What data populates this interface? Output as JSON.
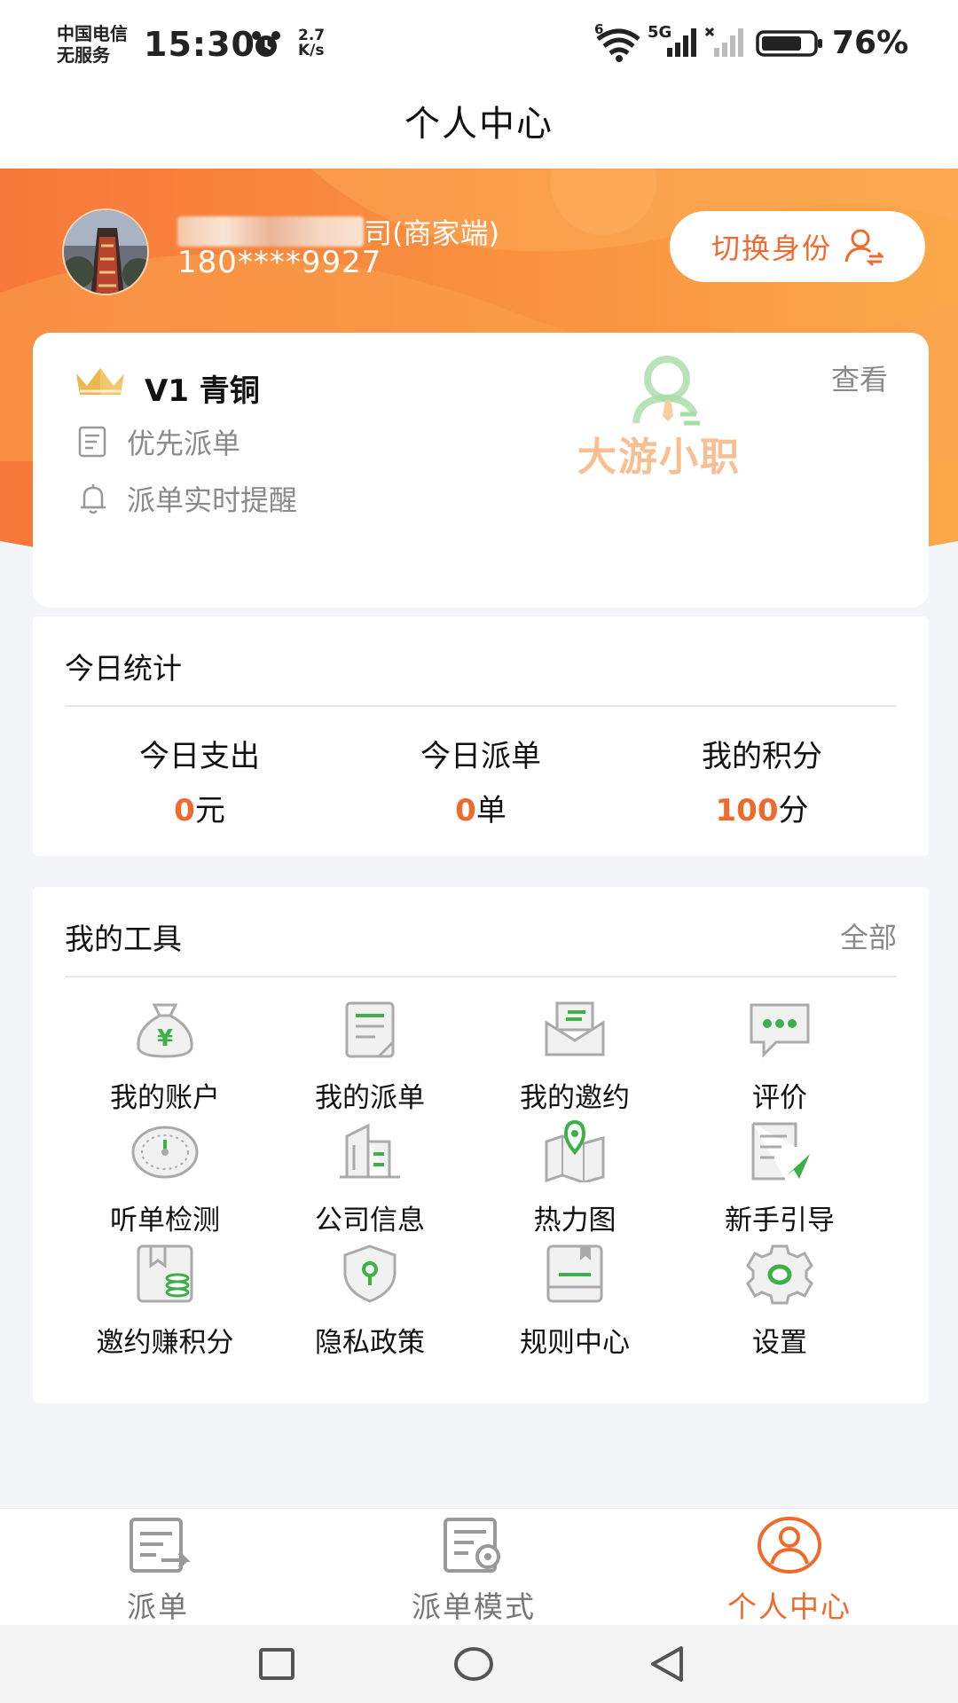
{
  "status_bar": {
    "carrier_line1": "中国电信",
    "carrier_line2": "无服务",
    "time": "15:30",
    "net_speed_value": "2.7",
    "net_speed_unit": "K/s",
    "wifi_badge": "6",
    "network_type": "5G",
    "battery_percent": "76%"
  },
  "page": {
    "title": "个人中心"
  },
  "profile": {
    "company_suffix": "司(商家端)",
    "phone": "180****9927",
    "switch_identity_label": "切换身份"
  },
  "level_card": {
    "level": "V1 青铜",
    "view_label": "查看",
    "perks": [
      "优先派单",
      "派单实时提醒"
    ],
    "watermark": "大游小职"
  },
  "stats": {
    "title": "今日统计",
    "items": [
      {
        "label": "今日支出",
        "value": "0",
        "unit": "元"
      },
      {
        "label": "今日派单",
        "value": "0",
        "unit": "单"
      },
      {
        "label": "我的积分",
        "value": "100",
        "unit": "分"
      }
    ]
  },
  "tools": {
    "title": "我的工具",
    "all_label": "全部",
    "items": [
      {
        "label": "我的账户",
        "icon": "money-bag-icon"
      },
      {
        "label": "我的派单",
        "icon": "clipboard-icon"
      },
      {
        "label": "我的邀约",
        "icon": "envelope-icon"
      },
      {
        "label": "评价",
        "icon": "chat-bubble-icon"
      },
      {
        "label": "听单检测",
        "icon": "gauge-icon"
      },
      {
        "label": "公司信息",
        "icon": "building-icon"
      },
      {
        "label": "热力图",
        "icon": "map-pin-icon"
      },
      {
        "label": "新手引导",
        "icon": "guide-icon"
      },
      {
        "label": "邀约赚积分",
        "icon": "coins-icon"
      },
      {
        "label": "隐私政策",
        "icon": "shield-icon"
      },
      {
        "label": "规则中心",
        "icon": "rules-book-icon"
      },
      {
        "label": "设置",
        "icon": "gear-icon"
      }
    ]
  },
  "bottom_nav": {
    "items": [
      {
        "label": "派单",
        "icon": "dispatch-icon"
      },
      {
        "label": "派单模式",
        "icon": "dispatch-mode-icon"
      },
      {
        "label": "个人中心",
        "icon": "profile-icon",
        "active": true
      }
    ]
  },
  "colors": {
    "accent": "#ef6a2c",
    "green": "#3db04a",
    "gray_icon": "#a8a8a8"
  }
}
